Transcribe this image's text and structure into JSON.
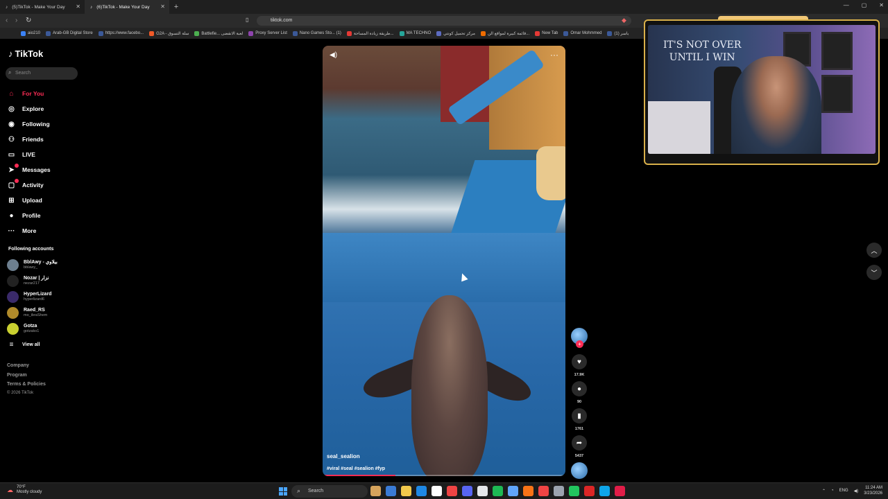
{
  "browser": {
    "tabs": [
      {
        "title": "(5)TikTok - Make Your Day"
      },
      {
        "title": "(6)TikTok - Make Your Day"
      }
    ],
    "url": "tiktok.com",
    "bookmarks": [
      {
        "label": "aio210",
        "color": "#3b82f6"
      },
      {
        "label": "Arab-GB Digital Store",
        "color": "#3b5998"
      },
      {
        "label": "https://www.facebo...",
        "color": "#3b5998"
      },
      {
        "label": "G2A - سلة التسوق",
        "color": "#f05a28"
      },
      {
        "label": "Battlefie... لعبة الانقضى",
        "color": "#4caf50"
      },
      {
        "label": "Proxy Server List",
        "color": "#8e44ad"
      },
      {
        "label": "Nano Games Sto... (1)",
        "color": "#3b5998"
      },
      {
        "label": "طريقة زيادة المساحة...",
        "color": "#e53935"
      },
      {
        "label": "MA TECHNO",
        "color": "#26a69a"
      },
      {
        "label": "مركز تحميل كونتي",
        "color": "#5c6bc0"
      },
      {
        "label": "قائمة كبيرة لمواقع الن...",
        "color": "#ef6c00"
      },
      {
        "label": "New Tab",
        "color": "#e53935"
      },
      {
        "label": "Omar Mohmmed",
        "color": "#3b5998"
      },
      {
        "label": "(1) ياسر",
        "color": "#3b5998"
      }
    ]
  },
  "sidebar": {
    "brand": "TikTok",
    "search_placeholder": "Search",
    "nav": [
      {
        "label": "For You",
        "icon": "home-icon",
        "glyph": "⌂"
      },
      {
        "label": "Explore",
        "icon": "compass-icon",
        "glyph": "◎"
      },
      {
        "label": "Following",
        "icon": "following-icon",
        "glyph": "◉"
      },
      {
        "label": "Friends",
        "icon": "friends-icon",
        "glyph": "⚇"
      },
      {
        "label": "LIVE",
        "icon": "live-icon",
        "glyph": "▭"
      },
      {
        "label": "Messages",
        "icon": "messages-icon",
        "glyph": "➤"
      },
      {
        "label": "Activity",
        "icon": "activity-icon",
        "glyph": "▢"
      },
      {
        "label": "Upload",
        "icon": "upload-icon",
        "glyph": "⊞"
      },
      {
        "label": "Profile",
        "icon": "profile-icon",
        "glyph": "●"
      },
      {
        "label": "More",
        "icon": "more-icon",
        "glyph": "···"
      }
    ],
    "following_title": "Following accounts",
    "accounts": [
      {
        "name": "BblAwy - بيلاوي",
        "handle": "bblawy_",
        "color": "#6d7f8f"
      },
      {
        "name": "Nozar | نزار",
        "handle": "nezar217",
        "color": "#222"
      },
      {
        "name": "HyperLizard",
        "handle": "hyperlizard6",
        "color": "#3a2a6a"
      },
      {
        "name": "Raed_RS",
        "handle": "mo_ibraShem",
        "color": "#b08a2a"
      },
      {
        "name": "Gotza",
        "handle": "gotzako1",
        "color": "#c9d030"
      }
    ],
    "view_all": "View all",
    "footer": [
      "Company",
      "Program",
      "Terms & Policies"
    ],
    "copyright": "© 2026 TikTok"
  },
  "video": {
    "author": "seal_sealion",
    "caption": "#viral #seal #sealion #fyp",
    "progress": 0.3
  },
  "actions": {
    "likes": "17.9K",
    "comments": "90",
    "saves": "1761",
    "shares": "5437"
  },
  "webcam": {
    "wall_text_line1": "IT'S NOT OVER",
    "wall_text_line2": "UNTIL I WIN"
  },
  "taskbar": {
    "weather_temp": "70°F",
    "weather_desc": "Mostly cloudy",
    "search_label": "Search",
    "lang": "ENG",
    "time": "11:24 AM",
    "date": "3/23/2026",
    "apps": [
      "#d6a35c",
      "#3a7bd5",
      "#f2c94c",
      "#1e88e5",
      "#ffffff",
      "#ef4444",
      "#5865f2",
      "#e5e7eb",
      "#1db954",
      "#60a5fa",
      "#f97316",
      "#ef4444",
      "#9ca3af",
      "#22c55e",
      "#dc2626",
      "#0ea5e9",
      "#e11d48"
    ]
  }
}
